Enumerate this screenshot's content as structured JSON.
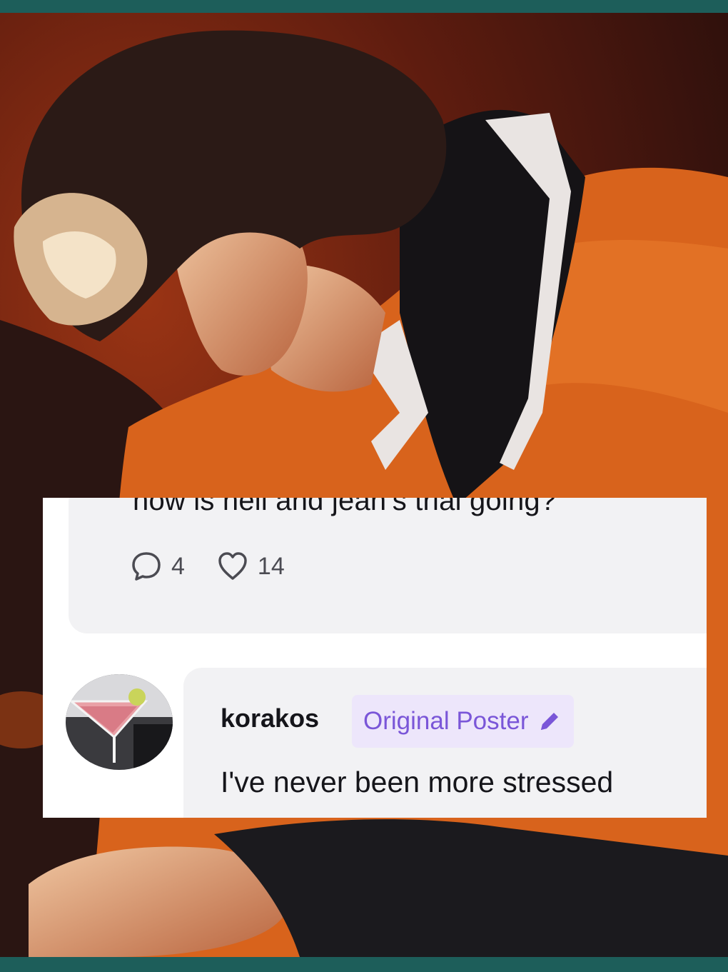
{
  "post": {
    "question": "how is neil and jean’s trial going?",
    "comments_count": "4",
    "likes_count": "14",
    "icons": {
      "comments": "speech-bubble-icon",
      "likes": "heart-icon"
    }
  },
  "reply": {
    "username": "korakos",
    "badge_label": "Original Poster",
    "badge_icon": "pencil-icon",
    "text": "I've never been more stressed"
  },
  "colors": {
    "frame": "#1d5e5a",
    "panel": "#f2f2f4",
    "badge_bg": "#ede6fb",
    "badge_text": "#7a56d8",
    "jacket": "#d8631c"
  }
}
